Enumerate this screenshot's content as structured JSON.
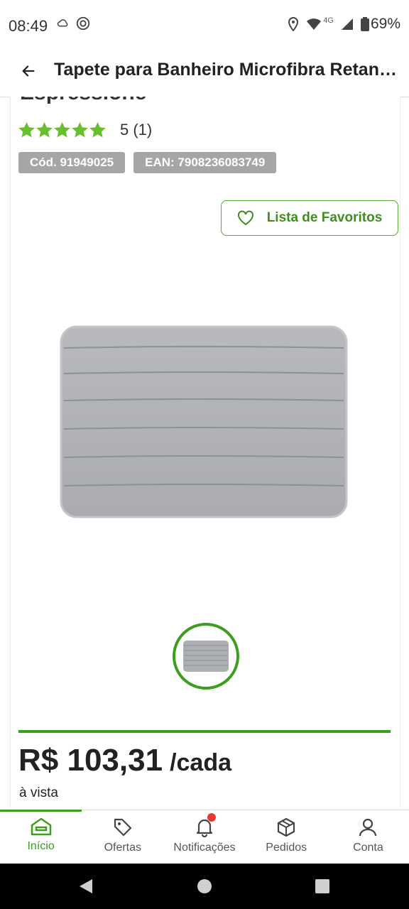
{
  "status_bar": {
    "time": "08:49",
    "network": "4G",
    "battery": "69%"
  },
  "header": {
    "title": "Tapete para Banheiro Microfibra Retangular Espressione"
  },
  "product": {
    "title_fragment": "Espressione",
    "rating": {
      "stars": 5,
      "text": "5 (1)"
    },
    "code": "Cód. 91949025",
    "ean": "EAN: 7908236083749",
    "favorites_label": "Lista de Favoritos",
    "price": "R$ 103,31",
    "price_unit": "/cada",
    "price_note": "à vista"
  },
  "colors": {
    "accent": "#3d9d1e",
    "star": "#6abf2f",
    "badge": "#a6a6a6",
    "notification": "#e53935"
  },
  "nav": {
    "items": [
      {
        "label": "Início",
        "icon": "home-icon",
        "active": true
      },
      {
        "label": "Ofertas",
        "icon": "tag-icon"
      },
      {
        "label": "Notificações",
        "icon": "bell-icon"
      },
      {
        "label": "Pedidos",
        "icon": "package-icon"
      },
      {
        "label": "Conta",
        "icon": "user-icon"
      }
    ]
  }
}
